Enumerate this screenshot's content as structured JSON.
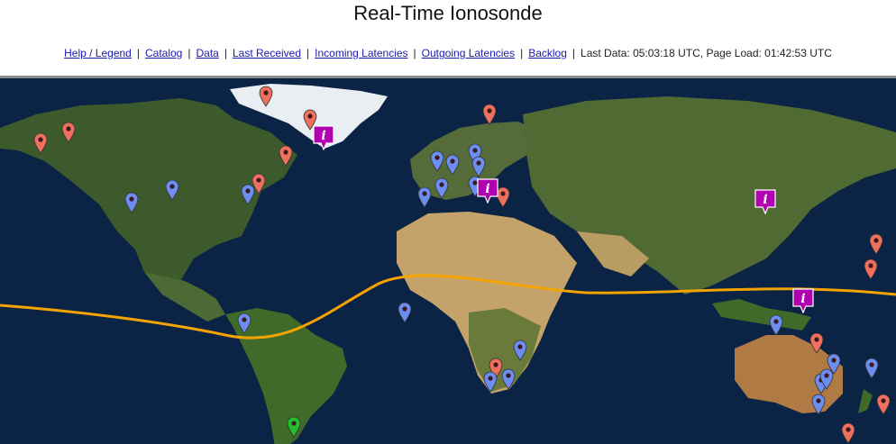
{
  "header": {
    "title": "Real-Time Ionosonde"
  },
  "nav": {
    "links": [
      {
        "label": "Help / Legend"
      },
      {
        "label": "Catalog"
      },
      {
        "label": "Data"
      },
      {
        "label": "Last Received"
      },
      {
        "label": "Incoming Latencies"
      },
      {
        "label": "Outgoing Latencies"
      },
      {
        "label": "Backlog"
      }
    ],
    "separator": "|",
    "status": "Last Data: 05:03:18 UTC, Page Load: 01:42:53 UTC"
  },
  "map": {
    "colors": {
      "ocean": "#0b2344",
      "equator_line": "#f5a300",
      "pin_red": "#f07060",
      "pin_blue": "#6b8ef0",
      "pin_green": "#22c02a",
      "info_marker": "#b000b0"
    },
    "icons": {
      "pin": "map-pin-icon",
      "info": "info-marker-icon"
    },
    "pin_counts": {
      "red": 19,
      "blue": 27,
      "green": 1,
      "info": 4
    }
  }
}
